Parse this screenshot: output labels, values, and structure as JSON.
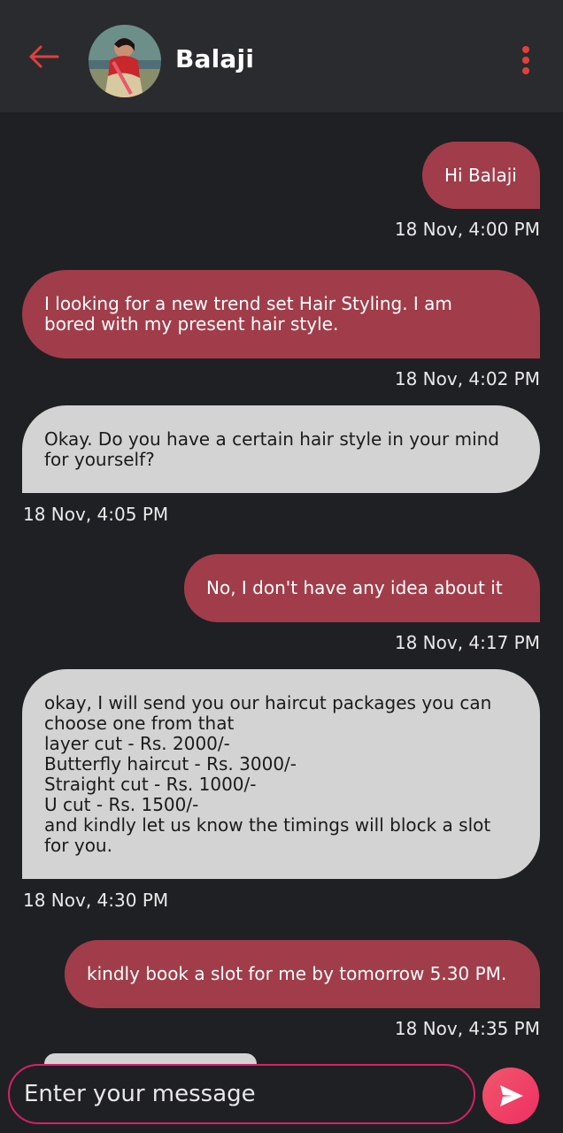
{
  "header": {
    "contact_name": "Balaji",
    "accent_color": "#e0413b"
  },
  "messages": [
    {
      "direction": "out",
      "text": "Hi Balaji",
      "time": "18 Nov, 4:00 PM"
    },
    {
      "direction": "out",
      "text": "I looking for a new trend set Hair Styling. I am\nbored with my present hair style.",
      "time": "18 Nov, 4:02 PM"
    },
    {
      "direction": "in",
      "text": "Okay. Do you have a certain hair style in your mind\nfor yourself?",
      "time": "18 Nov, 4:05 PM"
    },
    {
      "direction": "out",
      "text": "No, I don't have any idea about it",
      "time": "18 Nov, 4:17 PM"
    },
    {
      "direction": "in",
      "text": "okay, I will send you our haircut packages you can\nchoose one from that\nlayer cut - Rs. 2000/-\nButterfly haircut - Rs. 3000/-\nStraight cut - Rs. 1000/-\nU cut - Rs. 1500/-\nand kindly let us know the timings will block a slot\nfor you.",
      "time": "18 Nov, 4:30 PM"
    },
    {
      "direction": "out",
      "text": "kindly book a slot for me by tomorrow 5.30 PM.",
      "time": "18 Nov, 4:35 PM"
    }
  ],
  "composer": {
    "placeholder": "Enter your message"
  },
  "colors": {
    "outgoing_bubble": "#a13d4a",
    "incoming_bubble": "#d3d3d3",
    "background": "#1f2023",
    "send_button": "#ef3f66"
  },
  "icons": {
    "back": "arrow-left-icon",
    "menu": "more-vertical-icon",
    "send": "send-icon"
  }
}
